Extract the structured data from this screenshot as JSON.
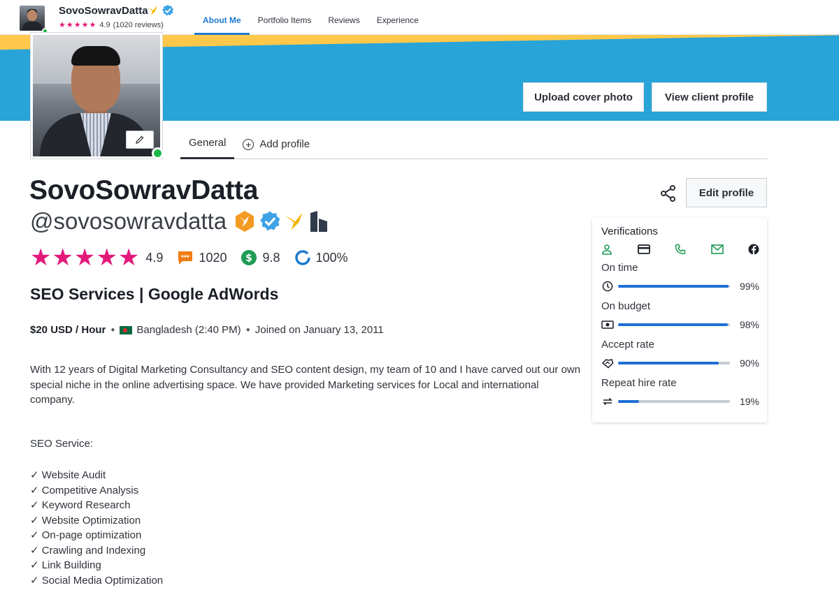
{
  "nav": {
    "name": "SovoSowravDatta",
    "rating": "4.9",
    "reviews": "(1020 reviews)",
    "tabs": [
      {
        "label": "About Me",
        "active": true
      },
      {
        "label": "Portfolio Items",
        "active": false
      },
      {
        "label": "Reviews",
        "active": false
      },
      {
        "label": "Experience",
        "active": false
      }
    ]
  },
  "cover": {
    "upload_label": "Upload cover photo",
    "view_client_label": "View client profile"
  },
  "subtabs": {
    "general": "General",
    "add_profile": "Add profile"
  },
  "profile": {
    "name": "SovoSowravDatta",
    "handle": "@sovosowravdatta",
    "rating": "4.9",
    "review_count": "1020",
    "earnings_score": "9.8",
    "completion": "100%",
    "headline": "SEO Services | Google AdWords",
    "rate": "$20 USD / Hour",
    "location": "Bangladesh (2:40 PM)",
    "joined": "Joined on January 13, 2011",
    "description": "With 12 years of Digital Marketing Consultancy and SEO content design, my team of 10 and I have carved out our own special niche in the online advertising space. We have provided Marketing services for Local and international company.",
    "services_title": "SEO Service:",
    "services": [
      "✓ Website Audit",
      "✓ Competitive Analysis",
      "✓ Keyword Research",
      "✓ Website Optimization",
      "✓ On-page optimization",
      "✓ Crawling and Indexing",
      "✓ Link Building",
      "✓ Social Media Optimization"
    ]
  },
  "actions": {
    "edit_profile": "Edit profile"
  },
  "verifications": {
    "title": "Verifications",
    "metrics": [
      {
        "label": "On time",
        "percent": "99%",
        "value": 0.99
      },
      {
        "label": "On budget",
        "percent": "98%",
        "value": 0.98
      },
      {
        "label": "Accept rate",
        "percent": "90%",
        "value": 0.9
      },
      {
        "label": "Repeat hire rate",
        "percent": "19%",
        "value": 0.19
      }
    ]
  },
  "colors": {
    "star": "#e3197a",
    "accent": "#1f7ad1",
    "cover": "#29a4d8",
    "verified_green": "#1e9b54",
    "bar": "#1f6fd6"
  }
}
